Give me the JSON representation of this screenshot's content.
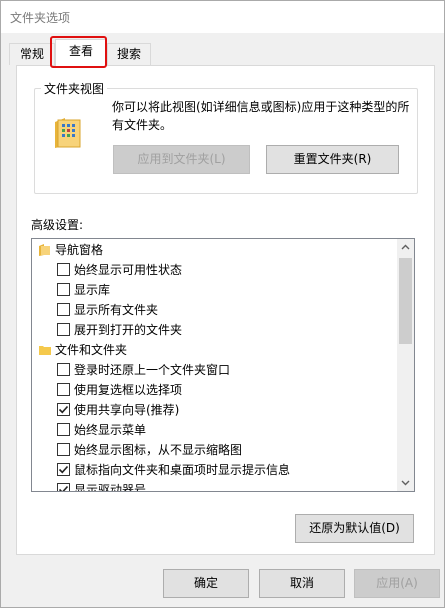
{
  "window": {
    "title": "文件夹选项"
  },
  "tabs": [
    {
      "label": "常规"
    },
    {
      "label": "查看"
    },
    {
      "label": "搜索"
    }
  ],
  "folder_views": {
    "title": "文件夹视图",
    "description": "你可以将此视图(如详细信息或图标)应用于这种类型的所有文件夹。",
    "apply_button": "应用到文件夹(L)",
    "reset_button": "重置文件夹(R)"
  },
  "advanced": {
    "label": "高级设置:",
    "items": [
      {
        "type": "category",
        "label": "导航窗格"
      },
      {
        "type": "option",
        "label": "始终显示可用性状态",
        "checked": false
      },
      {
        "type": "option",
        "label": "显示库",
        "checked": false
      },
      {
        "type": "option",
        "label": "显示所有文件夹",
        "checked": false
      },
      {
        "type": "option",
        "label": "展开到打开的文件夹",
        "checked": false
      },
      {
        "type": "category",
        "label": "文件和文件夹"
      },
      {
        "type": "option",
        "label": "登录时还原上一个文件夹窗口",
        "checked": false
      },
      {
        "type": "option",
        "label": "使用复选框以选择项",
        "checked": false
      },
      {
        "type": "option",
        "label": "使用共享向导(推荐)",
        "checked": true
      },
      {
        "type": "option",
        "label": "始终显示菜单",
        "checked": false
      },
      {
        "type": "option",
        "label": "始终显示图标，从不显示缩略图",
        "checked": false
      },
      {
        "type": "option",
        "label": "鼠标指向文件夹和桌面项时显示提示信息",
        "checked": true
      },
      {
        "type": "option",
        "label": "显示驱动器号",
        "checked": true
      }
    ],
    "restore_button": "还原为默认值(D)"
  },
  "footer": {
    "ok": "确定",
    "cancel": "取消",
    "apply": "应用(A)"
  },
  "colors": {
    "highlight": "#e01010",
    "folder": "#f5c94c"
  }
}
